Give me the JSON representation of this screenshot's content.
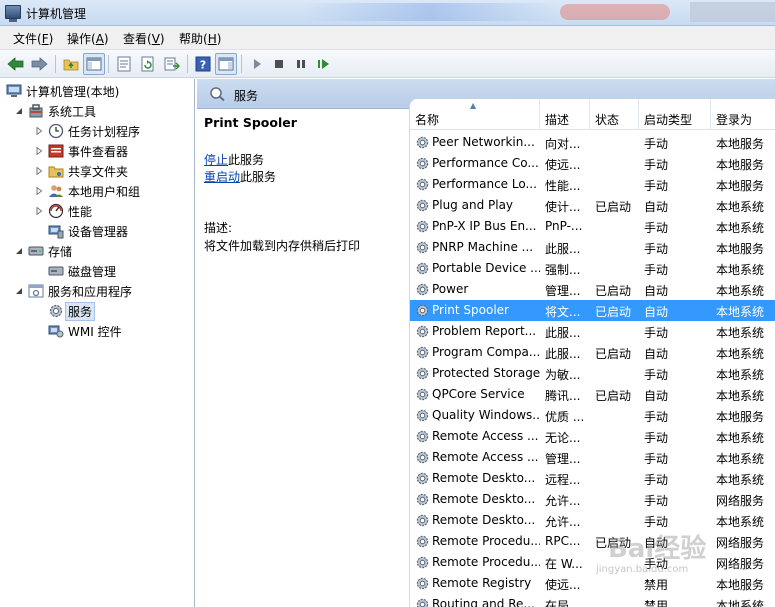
{
  "window": {
    "title": "计算机管理"
  },
  "menu": [
    {
      "text": "文件(",
      "acc": "F",
      "end": ")"
    },
    {
      "text": "操作(",
      "acc": "A",
      "end": ")"
    },
    {
      "text": "查看(",
      "acc": "V",
      "end": ")"
    },
    {
      "text": "帮助(",
      "acc": "H",
      "end": ")"
    }
  ],
  "toolbar": {
    "icons": [
      "back-arrow-icon",
      "forward-arrow-icon",
      "up-folder-icon",
      "show-hide-tree-icon",
      "properties-icon",
      "refresh-icon",
      "export-list-icon",
      "help-icon",
      "action-pane-icon",
      "start-service-icon",
      "stop-service-icon",
      "pause-service-icon",
      "restart-service-icon"
    ]
  },
  "tree": [
    {
      "label": "计算机管理(本地)",
      "icon": "computer-management-icon",
      "twisty": "",
      "indent": 0
    },
    {
      "label": "系统工具",
      "icon": "system-tools-icon",
      "twisty": "expanded",
      "indent": 1
    },
    {
      "label": "任务计划程序",
      "icon": "task-scheduler-icon",
      "twisty": "collapsed",
      "indent": 2
    },
    {
      "label": "事件查看器",
      "icon": "event-viewer-icon",
      "twisty": "collapsed",
      "indent": 2
    },
    {
      "label": "共享文件夹",
      "icon": "shared-folders-icon",
      "twisty": "collapsed",
      "indent": 2
    },
    {
      "label": "本地用户和组",
      "icon": "local-users-groups-icon",
      "twisty": "collapsed",
      "indent": 2
    },
    {
      "label": "性能",
      "icon": "performance-icon",
      "twisty": "collapsed",
      "indent": 2
    },
    {
      "label": "设备管理器",
      "icon": "device-manager-icon",
      "twisty": "",
      "indent": 2
    },
    {
      "label": "存储",
      "icon": "storage-icon",
      "twisty": "expanded",
      "indent": 1
    },
    {
      "label": "磁盘管理",
      "icon": "disk-management-icon",
      "twisty": "",
      "indent": 2
    },
    {
      "label": "服务和应用程序",
      "icon": "services-apps-icon",
      "twisty": "expanded",
      "indent": 1
    },
    {
      "label": "服务",
      "icon": "services-gear-icon",
      "twisty": "",
      "indent": 2,
      "selected": true
    },
    {
      "label": "WMI 控件",
      "icon": "wmi-control-icon",
      "twisty": "",
      "indent": 2
    }
  ],
  "services_header": {
    "title": "服务"
  },
  "extended": {
    "service_name": "Print Spooler",
    "stop_link": "停止",
    "stop_suffix": "此服务",
    "restart_link": "重启动",
    "restart_suffix": "此服务",
    "desc_label": "描述:",
    "desc_text": "将文件加载到内存供稍后打印"
  },
  "list": {
    "columns": [
      "名称",
      "描述",
      "状态",
      "启动类型",
      "登录为"
    ],
    "rows": [
      {
        "name": "Peer Networkin...",
        "desc": "向对...",
        "status": "",
        "startup": "手动",
        "logon": "本地服务"
      },
      {
        "name": "Performance Co...",
        "desc": "使远...",
        "status": "",
        "startup": "手动",
        "logon": "本地服务"
      },
      {
        "name": "Performance Lo...",
        "desc": "性能...",
        "status": "",
        "startup": "手动",
        "logon": "本地服务"
      },
      {
        "name": "Plug and Play",
        "desc": "使计...",
        "status": "已启动",
        "startup": "自动",
        "logon": "本地系统"
      },
      {
        "name": "PnP-X IP Bus En...",
        "desc": "PnP-...",
        "status": "",
        "startup": "手动",
        "logon": "本地系统"
      },
      {
        "name": "PNRP Machine ...",
        "desc": "此服...",
        "status": "",
        "startup": "手动",
        "logon": "本地服务"
      },
      {
        "name": "Portable Device ...",
        "desc": "强制...",
        "status": "",
        "startup": "手动",
        "logon": "本地系统"
      },
      {
        "name": "Power",
        "desc": "管理...",
        "status": "已启动",
        "startup": "自动",
        "logon": "本地系统"
      },
      {
        "name": "Print Spooler",
        "desc": "将文...",
        "status": "已启动",
        "startup": "自动",
        "logon": "本地系统",
        "selected": true
      },
      {
        "name": "Problem Report...",
        "desc": "此服...",
        "status": "",
        "startup": "手动",
        "logon": "本地系统"
      },
      {
        "name": "Program Compa...",
        "desc": "此服...",
        "status": "已启动",
        "startup": "自动",
        "logon": "本地系统"
      },
      {
        "name": "Protected Storage",
        "desc": "为敏...",
        "status": "",
        "startup": "手动",
        "logon": "本地系统"
      },
      {
        "name": "QPCore Service",
        "desc": "腾讯...",
        "status": "已启动",
        "startup": "自动",
        "logon": "本地系统"
      },
      {
        "name": "Quality Windows...",
        "desc": "优质 ...",
        "status": "",
        "startup": "手动",
        "logon": "本地服务"
      },
      {
        "name": "Remote Access ...",
        "desc": "无论...",
        "status": "",
        "startup": "手动",
        "logon": "本地系统"
      },
      {
        "name": "Remote Access ...",
        "desc": "管理...",
        "status": "",
        "startup": "手动",
        "logon": "本地系统"
      },
      {
        "name": "Remote Deskto...",
        "desc": "远程...",
        "status": "",
        "startup": "手动",
        "logon": "本地系统"
      },
      {
        "name": "Remote Deskto...",
        "desc": "允许...",
        "status": "",
        "startup": "手动",
        "logon": "网络服务"
      },
      {
        "name": "Remote Deskto...",
        "desc": "允许...",
        "status": "",
        "startup": "手动",
        "logon": "本地系统"
      },
      {
        "name": "Remote Procedu...",
        "desc": "RPC...",
        "status": "已启动",
        "startup": "自动",
        "logon": "网络服务"
      },
      {
        "name": "Remote Procedu...",
        "desc": "在 W...",
        "status": "",
        "startup": "手动",
        "logon": "网络服务"
      },
      {
        "name": "Remote Registry",
        "desc": "使远...",
        "status": "",
        "startup": "禁用",
        "logon": "本地服务"
      },
      {
        "name": "Routing and Re...",
        "desc": "在局...",
        "status": "",
        "startup": "禁用",
        "logon": "本地系统"
      }
    ]
  },
  "watermark": {
    "text": "Bai经验",
    "sub": "jingyan.baidu.com"
  },
  "colors": {
    "selection": "#3399ff",
    "header_blue": "#c3d6ee",
    "link": "#0645ad"
  }
}
